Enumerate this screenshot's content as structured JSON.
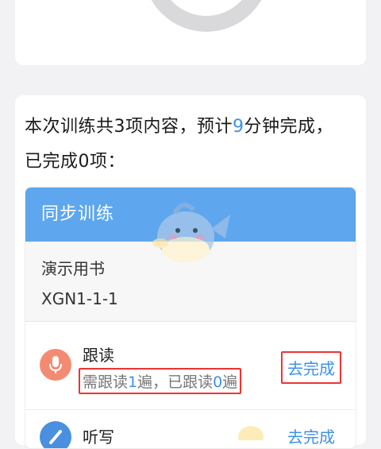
{
  "summary": {
    "part1": "本次训练共3项内容，预计",
    "minutes": "9",
    "part2": "分钟完成，已完成0项："
  },
  "task_card": {
    "header": "同步训练",
    "book_name": "演示用书",
    "book_code": "XGN1-1-1",
    "tasks": [
      {
        "title": "跟读",
        "desc_prefix": "需跟读",
        "required": "1",
        "desc_mid": "遍，已跟读",
        "done": "0",
        "desc_suffix": "遍",
        "button": "去完成"
      },
      {
        "title": "听写",
        "button": "去完成"
      }
    ]
  },
  "colors": {
    "accent": "#3d92e6",
    "header": "#5ea6ee",
    "mic_icon": "#f38b72",
    "highlight_box": "#e33333"
  },
  "icons": [
    "microphone-icon",
    "pencil-icon",
    "mascot-watermark"
  ]
}
